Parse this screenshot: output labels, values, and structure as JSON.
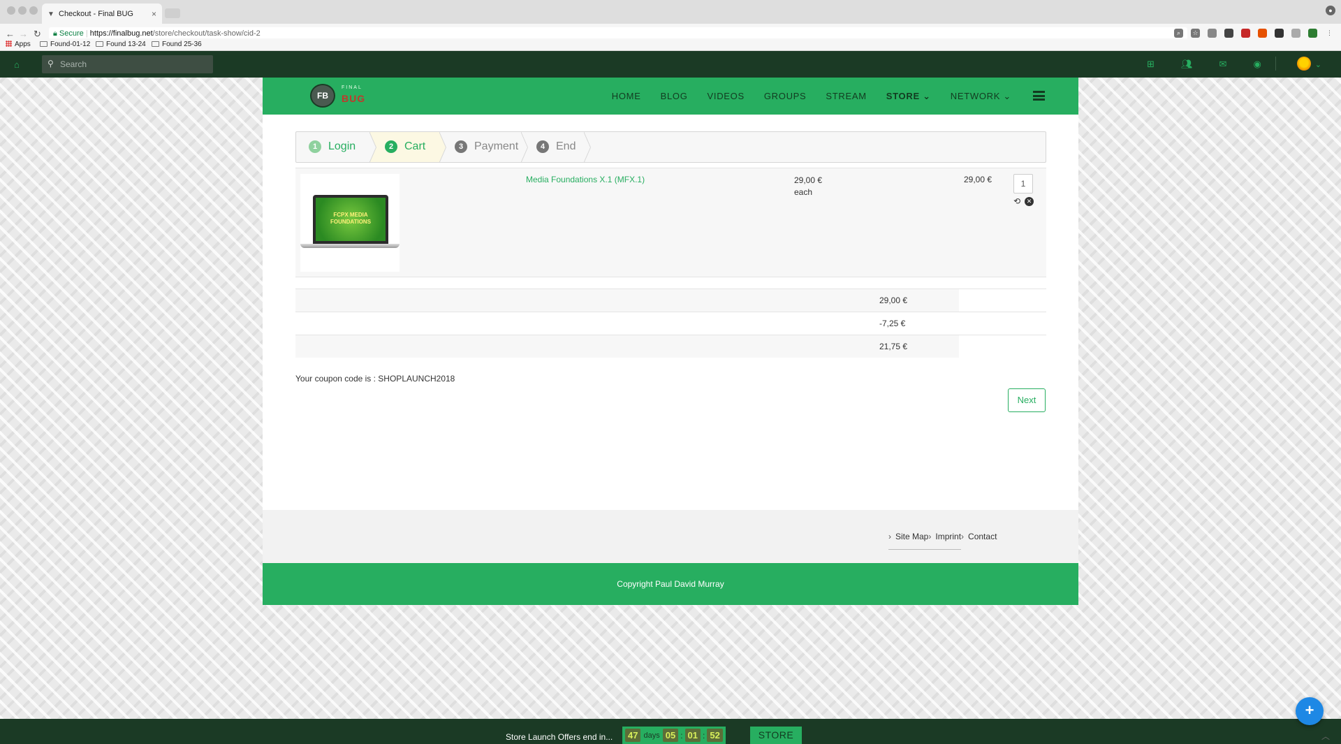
{
  "browser": {
    "tab_title": "Checkout - Final BUG",
    "tab_close": "×",
    "secure_label": "Secure",
    "url_scheme_host": "https://finalbug.net",
    "url_path": "/store/checkout/task-show/cid-2",
    "bookmarks": [
      "Apps",
      "Found-01-12",
      "Found 13-24",
      "Found 25-36"
    ]
  },
  "topbar": {
    "search_placeholder": "Search"
  },
  "site": {
    "logo_small": "FINAL",
    "logo_big": "BUG",
    "logo_badge": "FB",
    "nav": [
      "HOME",
      "BLOG",
      "VIDEOS",
      "GROUPS",
      "STREAM",
      "STORE",
      "NETWORK"
    ]
  },
  "steps": [
    {
      "num": "1",
      "label": "Login"
    },
    {
      "num": "2",
      "label": "Cart"
    },
    {
      "num": "3",
      "label": "Payment"
    },
    {
      "num": "4",
      "label": "End"
    }
  ],
  "cart": {
    "item": {
      "image_text": "FCPX MEDIA FOUNDATIONS",
      "name": "Media Foundations X.1 (MFX.1)",
      "unit_price": "29,00 €",
      "unit_label": "each",
      "quantity": "1",
      "total": "29,00 €"
    },
    "totals": [
      "29,00 €",
      "-7,25 €",
      "21,75 €"
    ],
    "coupon_text": "Your coupon code is : SHOPLAUNCH2018",
    "next_label": "Next"
  },
  "footer": {
    "links": [
      "Site Map",
      "Imprint",
      "Contact"
    ],
    "copyright": "Copyright Paul David Murray"
  },
  "countdown": {
    "message": "Store Launch Offers end in...",
    "days": "47",
    "days_label": "days",
    "hours": "05",
    "minutes": "01",
    "seconds": "52",
    "store_label": "STORE"
  },
  "colors": {
    "brand_green": "#27ae60",
    "dark_green": "#1b3a25",
    "fab_blue": "#1e88e5"
  }
}
